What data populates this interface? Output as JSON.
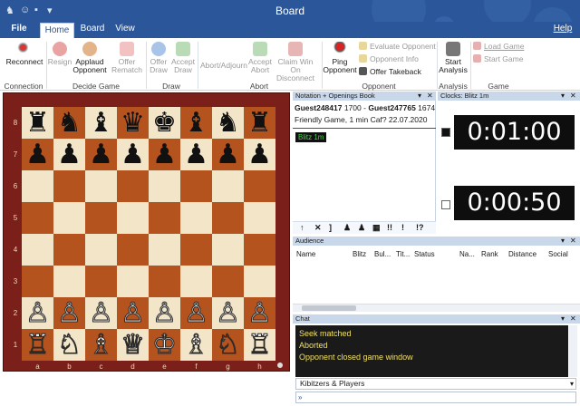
{
  "window": {
    "title": "Board"
  },
  "quick_access": {
    "icons": [
      "chess-horse-icon",
      "people-icon",
      "save-icon",
      "dropdown-icon"
    ]
  },
  "tabs": [
    {
      "label": "File",
      "active": false
    },
    {
      "label": "Home",
      "active": true
    },
    {
      "label": "Board",
      "active": false
    },
    {
      "label": "View",
      "active": false
    }
  ],
  "help_label": "Help",
  "ribbon": {
    "reconnect": "Reconnect",
    "resign": "Resign",
    "applaud_1": "Applaud",
    "applaud_2": "Opponent",
    "offer_rematch_1": "Offer",
    "offer_rematch_2": "Rematch",
    "offer_draw_1": "Offer",
    "offer_draw_2": "Draw",
    "accept_draw_1": "Accept",
    "accept_draw_2": "Draw",
    "abort_adjourn": "Abort/Adjourn",
    "accept_abort_1": "Accept",
    "accept_abort_2": "Abort",
    "claim_win_1": "Claim Win On",
    "claim_win_2": "Disconnect",
    "ping_1": "Ping",
    "ping_2": "Opponent",
    "evaluate_opponent": "Evaluate Opponent",
    "opponent_info": "Opponent Info",
    "offer_takeback": "Offer Takeback",
    "start_analysis_1": "Start",
    "start_analysis_2": "Analysis",
    "load_game": "Load Game",
    "start_game": "Start Game",
    "groups": {
      "connection": "Connection",
      "decide_game": "Decide Game",
      "draw": "Draw",
      "abort": "Abort",
      "opponent": "Opponent",
      "analysis": "Analysis",
      "game": "Game"
    }
  },
  "board": {
    "ranks": [
      "8",
      "7",
      "6",
      "5",
      "4",
      "3",
      "2",
      "1"
    ],
    "files": [
      "a",
      "b",
      "c",
      "d",
      "e",
      "f",
      "g",
      "h"
    ],
    "rows": [
      [
        "♜",
        "♞",
        "♝",
        "♛",
        "♚",
        "♝",
        "♞",
        "♜"
      ],
      [
        "♟",
        "♟",
        "♟",
        "♟",
        "♟",
        "♟",
        "♟",
        "♟"
      ],
      [
        "",
        "",
        "",
        "",
        "",
        "",
        "",
        ""
      ],
      [
        "",
        "",
        "",
        "",
        "",
        "",
        "",
        ""
      ],
      [
        "",
        "",
        "",
        "",
        "",
        "",
        "",
        ""
      ],
      [
        "",
        "",
        "",
        "",
        "",
        "",
        "",
        ""
      ],
      [
        "♙",
        "♙",
        "♙",
        "♙",
        "♙",
        "♙",
        "♙",
        "♙"
      ],
      [
        "♖",
        "♘",
        "♗",
        "♕",
        "♔",
        "♗",
        "♘",
        "♖"
      ]
    ],
    "colors": {
      "light": "#f3e6c8",
      "dark": "#b5531f",
      "frame": "#7a1f1a"
    }
  },
  "notation": {
    "header": "Notation + Openings Book",
    "player_white": "Guest248417",
    "rating_white": "1700",
    "separator": "-",
    "player_black": "Guest247765",
    "rating_black": "1674",
    "game_info": "Friendly Game, 1 min Caf? 22.07.2020",
    "game_type": "Blitz 1m",
    "toolbar": [
      "↑",
      "✕",
      "]",
      "♟",
      "♟",
      "▦",
      "!!",
      "!",
      "!?"
    ]
  },
  "clocks": {
    "header": "Clocks: Blitz 1m",
    "top_time": "0:01:00",
    "bottom_time": "0:00:50"
  },
  "audience": {
    "header": "Audience",
    "columns": [
      "Name",
      "Blitz",
      "Bul...",
      "Tit...",
      "Status",
      "Na...",
      "Rank",
      "Distance",
      "Social"
    ]
  },
  "chat": {
    "header": "Chat",
    "messages": [
      "Seek matched",
      "Aborted",
      "Opponent closed game window"
    ],
    "channel": "Kibitzers & Players",
    "input_placeholder": ""
  }
}
